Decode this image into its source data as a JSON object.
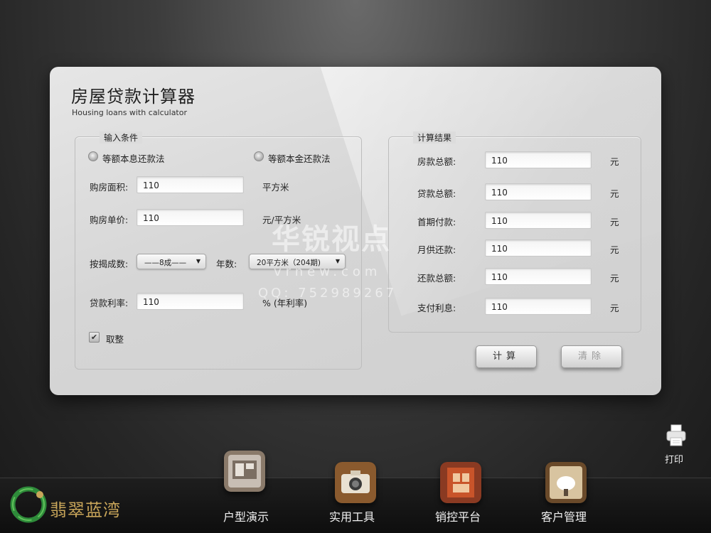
{
  "app": {
    "title": "房屋贷款计算器",
    "subtitle": "Housing loans with calculator"
  },
  "input_group": {
    "legend": "输入条件",
    "radio_1": "等额本息还款法",
    "radio_2": "等额本金还款法",
    "area_label": "购房面积:",
    "area_value": "110",
    "area_unit": "平方米",
    "price_label": "购房单价:",
    "price_value": "110",
    "price_unit": "元/平方米",
    "mortgage_label": "按揭成数:",
    "mortgage_value": "——8成——",
    "years_label": "年数:",
    "years_value": "20平方米（204期)",
    "rate_label": "贷款利率:",
    "rate_value": "110",
    "rate_unit": "% (年利率)",
    "round_label": "取整",
    "round_checked": true
  },
  "result_group": {
    "legend": "计算结果",
    "rows": [
      {
        "label": "房款总额:",
        "value": "110",
        "unit": "元"
      },
      {
        "label": "贷款总额:",
        "value": "110",
        "unit": "元"
      },
      {
        "label": "首期付款:",
        "value": "110",
        "unit": "元"
      },
      {
        "label": "月供还款:",
        "value": "110",
        "unit": "元"
      },
      {
        "label": "还款总额:",
        "value": "110",
        "unit": "元"
      },
      {
        "label": "支付利息:",
        "value": "110",
        "unit": "元"
      }
    ]
  },
  "buttons": {
    "calculate": "计算",
    "clear": "清除"
  },
  "watermark": {
    "brand": "华锐视点",
    "url": "vrnew.com",
    "qq": "QQ: 752989267"
  },
  "print": {
    "label": "打印",
    "icon": "printer-icon"
  },
  "logo": {
    "text": "翡翠蓝湾",
    "icon": "dragon-ring-logo"
  },
  "nav": [
    {
      "label": "户型演示",
      "icon": "floorplan-icon"
    },
    {
      "label": "实用工具",
      "icon": "camera-icon"
    },
    {
      "label": "销控平台",
      "icon": "door-icon"
    },
    {
      "label": "客户管理",
      "icon": "chair-icon"
    }
  ],
  "colors": {
    "panel": "#d9d9d9",
    "background": "#2a2a2a",
    "logo_gold": "#c9a65a",
    "logo_green": "#2e8b3a"
  }
}
